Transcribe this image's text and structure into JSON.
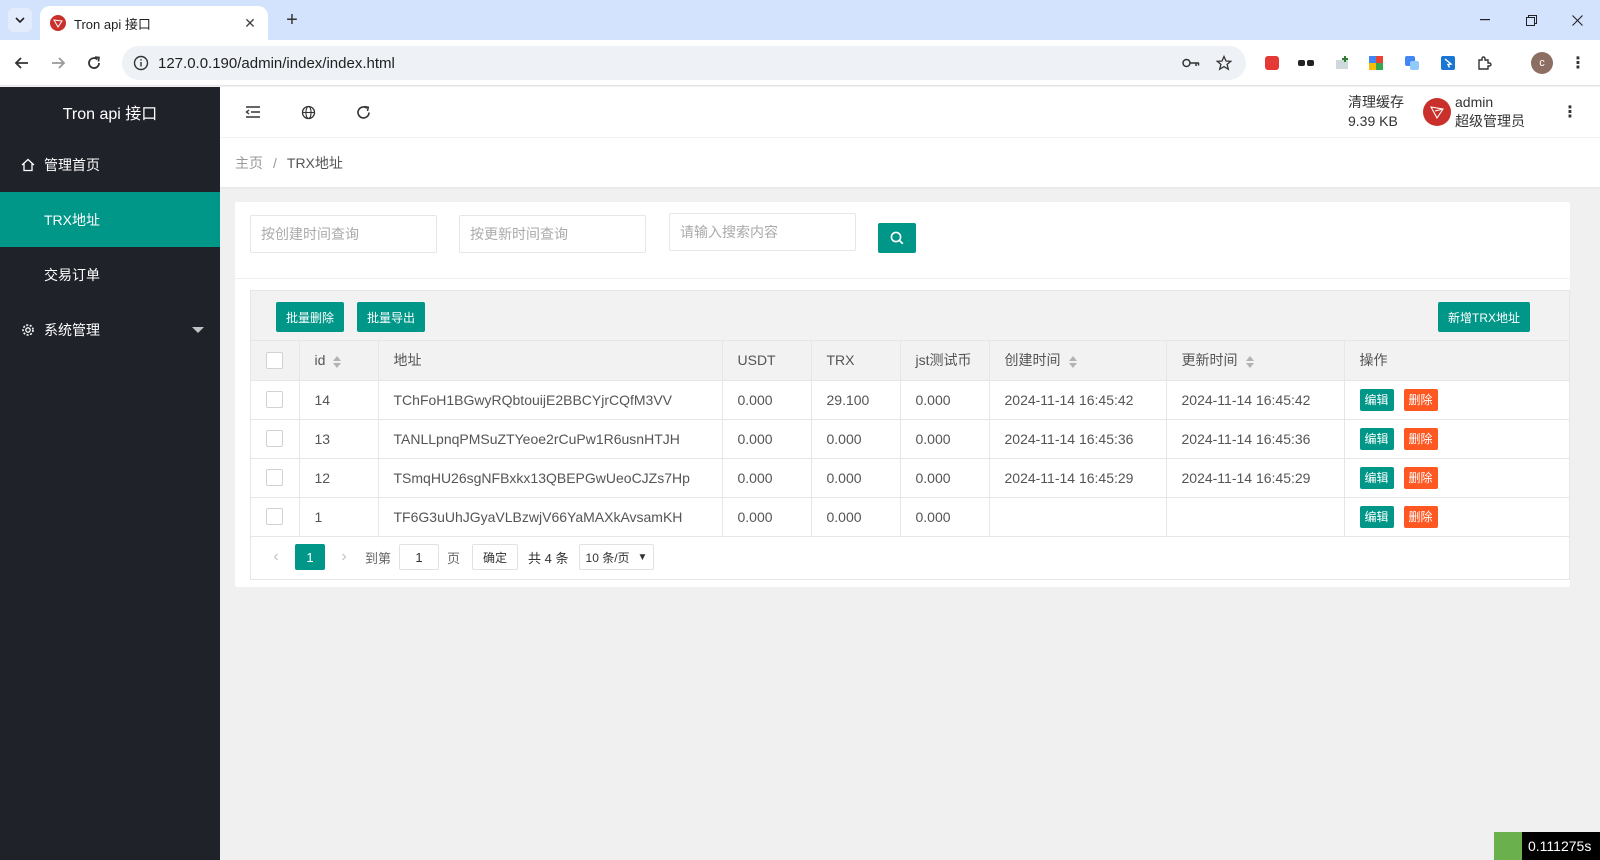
{
  "browser": {
    "tab_title": "Tron api 接口",
    "url": "127.0.0.190/admin/index/index.html",
    "profile_initial": "c"
  },
  "app": {
    "logo": "Tron api 接口",
    "accent": "#009688",
    "danger": "#ff5722",
    "sidebar": {
      "items": [
        {
          "label": "管理首页",
          "icon": "home-icon"
        },
        {
          "label": "TRX地址",
          "active": true
        },
        {
          "label": "交易订单"
        },
        {
          "label": "系统管理",
          "icon": "gear-icon",
          "expandable": true
        }
      ]
    },
    "header": {
      "cache_label": "清理缓存",
      "cache_size": "9.39 KB",
      "username": "admin",
      "role": "超级管理员"
    },
    "breadcrumb": {
      "home": "主页",
      "separator": "/",
      "current": "TRX地址"
    },
    "search": {
      "created_placeholder": "按创建时间查询",
      "updated_placeholder": "按更新时间查询",
      "keyword_placeholder": "请输入搜索内容"
    },
    "toolbar": {
      "batch_delete": "批量删除",
      "batch_export": "批量导出",
      "add_address": "新增TRX地址"
    },
    "table": {
      "columns": [
        "id",
        "地址",
        "USDT",
        "TRX",
        "jst测试币",
        "创建时间",
        "更新时间",
        "操作"
      ],
      "edit_label": "编辑",
      "delete_label": "删除",
      "rows": [
        {
          "id": "14",
          "address": "TChFoH1BGwyRQbtouijE2BBCYjrCQfM3VV",
          "usdt": "0.000",
          "trx": "29.100",
          "jst": "0.000",
          "created": "2024-11-14 16:45:42",
          "updated": "2024-11-14 16:45:42"
        },
        {
          "id": "13",
          "address": "TANLLpnqPMSuZTYeoe2rCuPw1R6usnHTJH",
          "usdt": "0.000",
          "trx": "0.000",
          "jst": "0.000",
          "created": "2024-11-14 16:45:36",
          "updated": "2024-11-14 16:45:36"
        },
        {
          "id": "12",
          "address": "TSmqHU26sgNFBxkx13QBEPGwUeoCJZs7Hp",
          "usdt": "0.000",
          "trx": "0.000",
          "jst": "0.000",
          "created": "2024-11-14 16:45:29",
          "updated": "2024-11-14 16:45:29"
        },
        {
          "id": "1",
          "address": "TF6G3uUhJGyaVLBzwjV66YaMAXkAvsamKH",
          "usdt": "0.000",
          "trx": "0.000",
          "jst": "0.000",
          "created": "",
          "updated": ""
        }
      ]
    },
    "pager": {
      "current_page": "1",
      "goto_label": "到第",
      "goto_value": "1",
      "page_unit": "页",
      "confirm": "确定",
      "total": "共 4 条",
      "page_size": "10 条/页"
    }
  },
  "timer": "0.111275s"
}
